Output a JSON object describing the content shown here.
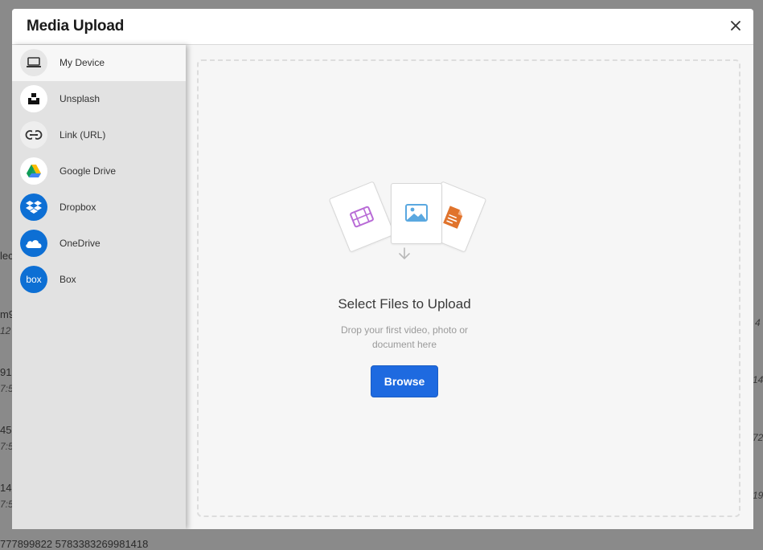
{
  "modal": {
    "title": "Media Upload"
  },
  "sidebar": {
    "items": [
      {
        "label": "My Device",
        "icon": "laptop-icon",
        "active": true
      },
      {
        "label": "Unsplash",
        "icon": "unsplash-icon",
        "active": false
      },
      {
        "label": "Link (URL)",
        "icon": "link-icon",
        "active": false
      },
      {
        "label": "Google Drive",
        "icon": "google-drive-icon",
        "active": false
      },
      {
        "label": "Dropbox",
        "icon": "dropbox-icon",
        "active": false
      },
      {
        "label": "OneDrive",
        "icon": "onedrive-icon",
        "active": false
      },
      {
        "label": "Box",
        "icon": "box-icon",
        "active": false
      }
    ]
  },
  "upload": {
    "title": "Select Files to Upload",
    "subtitle_line1": "Drop your first video, photo or",
    "subtitle_line2": "document here",
    "browse_label": "Browse"
  },
  "background_text": {
    "left": [
      "lec",
      "m9",
      "12",
      "91",
      "7:5",
      "45",
      "7:5",
      "14",
      "7:5"
    ],
    "right": [
      "4",
      "14",
      "72",
      "19"
    ],
    "bottom": "777899822 5783383269981418"
  },
  "colors": {
    "accent": "#1e6ae0",
    "dropbox": "#0d6fd4",
    "onedrive": "#0d6fd4",
    "box": "#0d6fd4",
    "video": "#b86bd6",
    "image": "#5aa8e0",
    "document": "#e0732c"
  }
}
